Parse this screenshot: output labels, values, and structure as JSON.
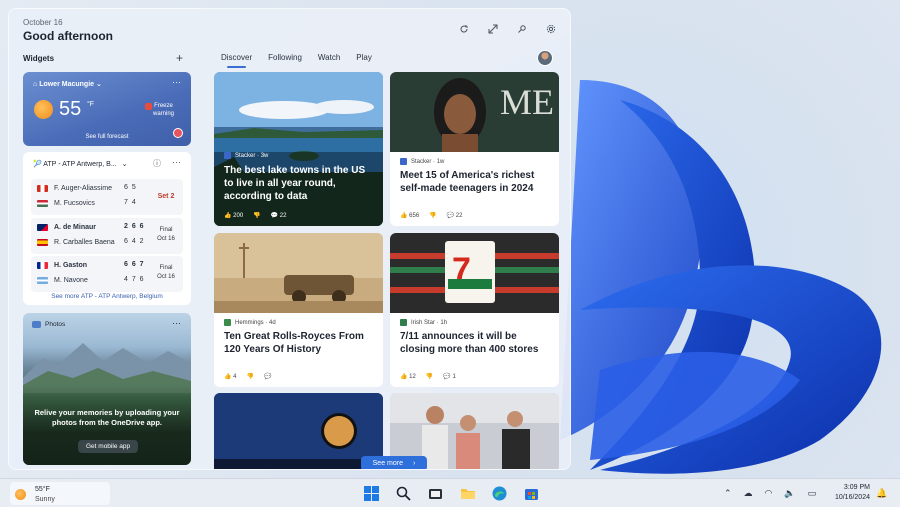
{
  "header": {
    "date": "October 16",
    "greeting": "Good afternoon"
  },
  "widgets": {
    "label": "Widgets",
    "add_icon": "+"
  },
  "tabs": [
    "Discover",
    "Following",
    "Watch",
    "Play"
  ],
  "weather": {
    "location": "Lower Macungie",
    "temp": "55",
    "unit": "°F",
    "alert_line1": "Freeze",
    "alert_line2": "warning",
    "forecast_link": "See full forecast"
  },
  "sports": {
    "title": "ATP - ATP Antwerp, B...",
    "matches": [
      {
        "players": [
          {
            "name": "F. Auger-Aliassime",
            "score": "6 5"
          },
          {
            "name": "M. Fucsovics",
            "score": "7 4"
          }
        ],
        "status": "Set 2",
        "live": true
      },
      {
        "players": [
          {
            "name": "A. de Minaur",
            "score": "2 6 6"
          },
          {
            "name": "R. Carballes Baena",
            "score": "6 4 2"
          }
        ],
        "status": "Final",
        "status_date": "Oct 16",
        "live": false
      },
      {
        "players": [
          {
            "name": "H. Gaston",
            "score": "6 6 7"
          },
          {
            "name": "M. Navone",
            "score": "4 7 6"
          }
        ],
        "status": "Final",
        "status_date": "Oct 16",
        "live": false
      }
    ],
    "more_link": "See more ATP - ATP Antwerp, Belgium"
  },
  "photos": {
    "label": "Photos",
    "message": "Relive your memories by uploading your photos from the OneDrive app.",
    "button": "Get mobile app"
  },
  "news": [
    {
      "source": "Stacker",
      "age": "3w",
      "title": "The best lake towns in the US to live in all year round, according to data",
      "likes": "200",
      "comments": "22"
    },
    {
      "source": "Stacker",
      "age": "1w",
      "title": "Meet 15 of America's richest self-made teenagers in 2024",
      "likes": "656",
      "comments": "22"
    },
    {
      "source": "Hemmings",
      "age": "4d",
      "title": "Ten Great Rolls-Royces From 120 Years Of History",
      "likes": "4",
      "comments": ""
    },
    {
      "source": "Irish Star",
      "age": "1h",
      "title": "7/11 announces it will be closing more than 400 stores",
      "likes": "12",
      "comments": "1"
    }
  ],
  "see_more": "See more",
  "taskbar": {
    "weather_temp": "55°F",
    "weather_desc": "Sunny",
    "time": "3:09 PM",
    "date": "10/16/2024"
  },
  "colors": {
    "accent": "#2f6fdc",
    "weather_bg": "#4a6cb8",
    "live_red": "#c0392b"
  }
}
